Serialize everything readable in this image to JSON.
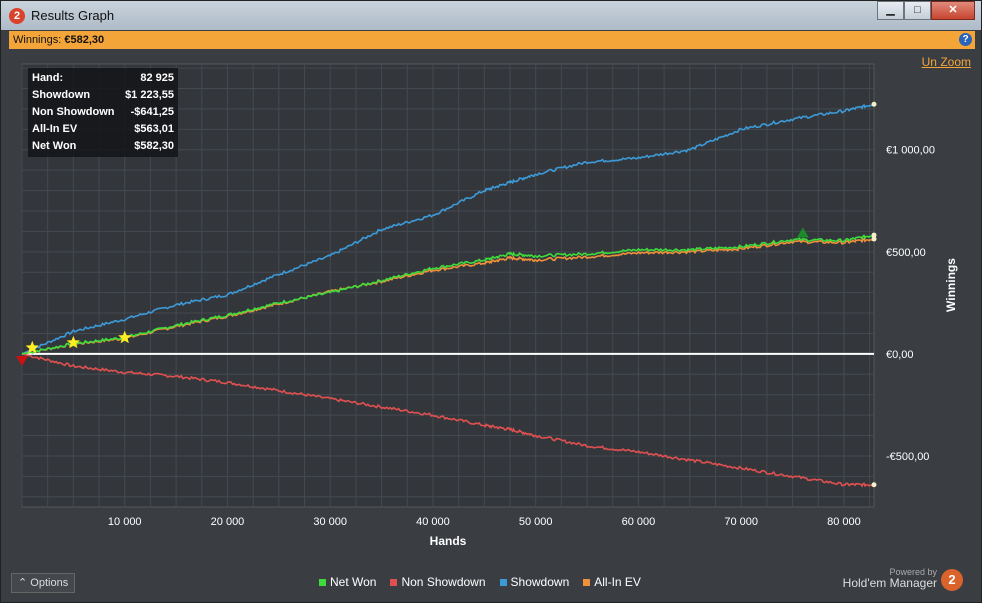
{
  "window": {
    "title": "Results Graph",
    "app_icon": "2"
  },
  "winbar": {
    "label": "Winnings:",
    "value": "€582,30",
    "help": "?"
  },
  "unzoom": "Un Zoom",
  "stats": [
    {
      "label": "Hand:",
      "value": "82 925"
    },
    {
      "label": "Showdown",
      "value": "$1 223,55"
    },
    {
      "label": "Non Showdown",
      "value": "-$641,25"
    },
    {
      "label": "All-In EV",
      "value": "$563,01"
    },
    {
      "label": "Net Won",
      "value": "$582,30"
    }
  ],
  "options_label": "Options",
  "powered": {
    "line1": "Powered by",
    "line2": "Hold'em Manager",
    "logo": "2"
  },
  "chart_data": {
    "type": "line",
    "xlabel": "Hands",
    "ylabel": "Winnings",
    "xlim": [
      0,
      82925
    ],
    "ylim": [
      -750,
      1420
    ],
    "x_ticks": [
      10000,
      20000,
      30000,
      40000,
      50000,
      60000,
      70000,
      80000
    ],
    "x_tick_labels": [
      "10 000",
      "20 000",
      "30 000",
      "40 000",
      "50 000",
      "60 000",
      "70 000",
      "80 000"
    ],
    "y_ticks": [
      -500,
      0,
      500,
      1000
    ],
    "y_tick_labels": [
      "-€500,00",
      "€0,00",
      "€500,00",
      "€1 000,00"
    ],
    "grid": true,
    "legend": "bottom",
    "x": [
      0,
      5000,
      10000,
      15000,
      20000,
      25000,
      30000,
      35000,
      40000,
      45000,
      47500,
      50000,
      55000,
      60000,
      65000,
      70000,
      75000,
      80000,
      82925
    ],
    "series": [
      {
        "name": "Net Won",
        "color": "#3ddc3d",
        "values": [
          0,
          50,
          80,
          140,
          190,
          250,
          300,
          360,
          420,
          460,
          490,
          480,
          490,
          510,
          510,
          525,
          560,
          555,
          582
        ]
      },
      {
        "name": "Non Showdown",
        "color": "#e05050",
        "values": [
          0,
          -60,
          -90,
          -110,
          -140,
          -180,
          -220,
          -260,
          -300,
          -350,
          -370,
          -400,
          -450,
          -480,
          -520,
          -560,
          -600,
          -640,
          -641
        ]
      },
      {
        "name": "Showdown",
        "color": "#3d9ad8",
        "values": [
          0,
          110,
          170,
          240,
          290,
          390,
          480,
          610,
          680,
          800,
          840,
          880,
          940,
          960,
          1000,
          1100,
          1150,
          1190,
          1223
        ]
      },
      {
        "name": "All-In EV",
        "color": "#f0903a",
        "values": [
          0,
          48,
          76,
          135,
          185,
          245,
          305,
          355,
          410,
          445,
          470,
          460,
          475,
          495,
          500,
          515,
          550,
          545,
          563
        ]
      }
    ],
    "markers": [
      {
        "type": "star",
        "color": "#ffee22",
        "x": 1000,
        "y": 30
      },
      {
        "type": "star",
        "color": "#ffee22",
        "x": 5000,
        "y": 55
      },
      {
        "type": "star",
        "color": "#ffee22",
        "x": 10000,
        "y": 80
      },
      {
        "type": "triangle-down",
        "color": "#cc1111",
        "x": 0,
        "y": -30
      },
      {
        "type": "triangle-up",
        "color": "#1a8a2a",
        "x": 76000,
        "y": 590
      }
    ]
  }
}
